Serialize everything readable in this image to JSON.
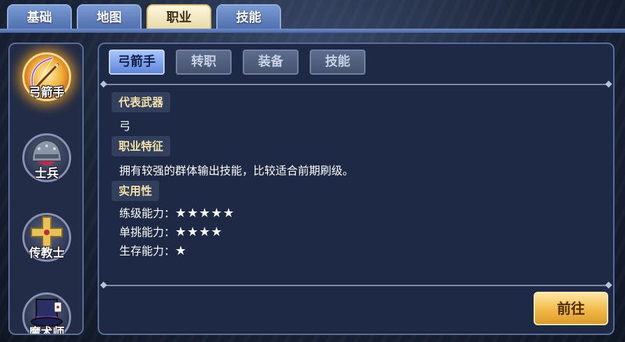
{
  "top_tabs": [
    {
      "label": "基础"
    },
    {
      "label": "地图"
    },
    {
      "label": "职业"
    },
    {
      "label": "技能"
    }
  ],
  "classes": [
    {
      "label": "弓箭手",
      "icon": "bow-icon",
      "selected": true
    },
    {
      "label": "士兵",
      "icon": "helmet-icon",
      "selected": false
    },
    {
      "label": "传教士",
      "icon": "cross-icon",
      "selected": false
    },
    {
      "label": "魔术师",
      "icon": "magician-hat-icon",
      "selected": false
    }
  ],
  "sub_tabs": [
    {
      "label": "弓箭手"
    },
    {
      "label": "转职"
    },
    {
      "label": "装备"
    },
    {
      "label": "技能"
    }
  ],
  "info": {
    "weapon_heading": "代表武器",
    "weapon_value": "弓",
    "feature_heading": "职业特征",
    "feature_value": "拥有较强的群体输出技能，比较适合前期刷级。",
    "practical_heading": "实用性",
    "ratings": [
      {
        "label": "练级能力：",
        "stars": "★★★★★",
        "value": 5
      },
      {
        "label": "单挑能力：",
        "stars": "★★★★",
        "value": 4
      },
      {
        "label": "生存能力：",
        "stars": "★",
        "value": 1
      }
    ]
  },
  "go_button": "前往",
  "colors": {
    "accent_gold": "#f2b948",
    "active_tab_blue": "#5f86d8",
    "panel": "#1e2a45"
  }
}
